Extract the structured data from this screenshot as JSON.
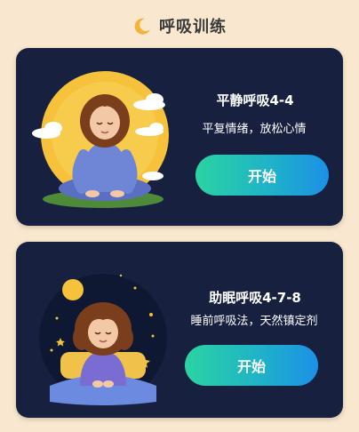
{
  "header": {
    "title": "呼吸训练",
    "icon": "moon-icon"
  },
  "exercises": [
    {
      "title": "平静呼吸4-4",
      "subtitle": "平复情绪，放松心情",
      "button_label": "开始",
      "illustration": "meditating-woman-image"
    },
    {
      "title": "助眠呼吸4-7-8",
      "subtitle": "睡前呼吸法，天然镇定剂",
      "button_label": "开始",
      "illustration": "sleeping-girl-image"
    }
  ],
  "colors": {
    "background": "#f9e8cf",
    "card": "#17213f",
    "button_gradient_start": "#2bd3a2",
    "button_gradient_end": "#1c90e6"
  }
}
